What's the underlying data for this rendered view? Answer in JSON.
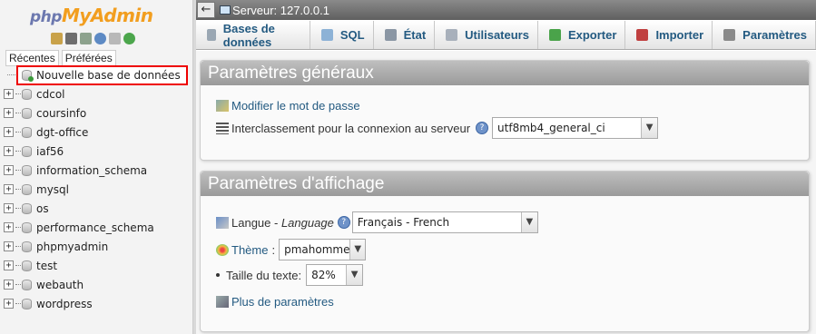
{
  "nav": {
    "logo_php": "php",
    "logo_my": "My",
    "logo_admin": "Admin",
    "tabs": [
      "Récentes",
      "Préférées"
    ],
    "new_db": "Nouvelle base de données",
    "databases": [
      "cdcol",
      "coursinfo",
      "dgt-office",
      "iaf56",
      "information_schema",
      "mysql",
      "os",
      "performance_schema",
      "phpmyadmin",
      "test",
      "webauth",
      "wordpress"
    ]
  },
  "topbar": {
    "back": "←",
    "breadcrumb": "Serveur: 127.0.0.1"
  },
  "menu": {
    "tabs": [
      {
        "label": "Bases de données",
        "icon": "database-icon",
        "color": "#9aa7b3"
      },
      {
        "label": "SQL",
        "icon": "sql-icon",
        "color": "#8db2d6"
      },
      {
        "label": "État",
        "icon": "status-icon",
        "color": "#8a96a4"
      },
      {
        "label": "Utilisateurs",
        "icon": "users-icon",
        "color": "#a8b0bb"
      },
      {
        "label": "Exporter",
        "icon": "export-icon",
        "color": "#4aa34a"
      },
      {
        "label": "Importer",
        "icon": "import-icon",
        "color": "#c04040"
      },
      {
        "label": "Paramètres",
        "icon": "settings-icon",
        "color": "#8a8a8a"
      }
    ]
  },
  "general": {
    "title": "Paramètres généraux",
    "change_password": "Modifier le mot de passe",
    "collation_label": "Interclassement pour la connexion au serveur",
    "collation_value": "utf8mb4_general_ci"
  },
  "display": {
    "title": "Paramètres d'affichage",
    "language_label": "Langue - ",
    "language_label_en": "Language",
    "language_value": "Français - French",
    "theme_label": "Thème",
    "theme_value": "pmahomme",
    "font_size_label": "Taille du texte:",
    "font_size_value": "82%",
    "more_settings": "Plus de paramètres"
  }
}
